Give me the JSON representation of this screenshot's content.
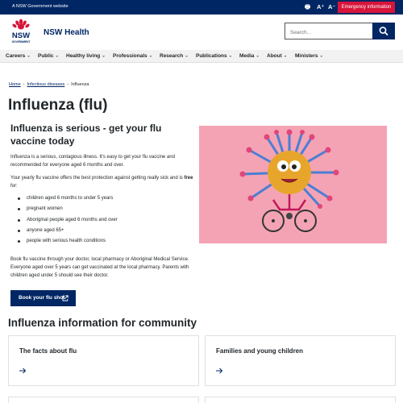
{
  "masthead": {
    "gov_label": "A NSW Government website",
    "print_label": "🖶",
    "font_up_label": "A⁺",
    "font_down_label": "A⁻",
    "emergency_label": "Emergency information"
  },
  "header": {
    "logo_text": "NSW",
    "logo_subtext": "GOVERNMENT",
    "brand": "NSW Health",
    "search_placeholder": "Search..."
  },
  "nav": {
    "items": [
      {
        "label": "Careers"
      },
      {
        "label": "Public"
      },
      {
        "label": "Healthy living"
      },
      {
        "label": "Professionals"
      },
      {
        "label": "Research"
      },
      {
        "label": "Publications"
      },
      {
        "label": "Media"
      },
      {
        "label": "About"
      },
      {
        "label": "Ministers"
      }
    ]
  },
  "breadcrumb": {
    "home": "Home",
    "section": "Infectious diseases",
    "current": "Influenza"
  },
  "page_title": "Influenza (flu)",
  "hero": {
    "title": "Influenza is serious - get your flu vaccine today",
    "intro": "Influenza is a serious, contagious illness. It's easy to get your flu vaccine and recommended for everyone aged 6 months and over.",
    "offer_prefix": "Your yearly flu vaccine offers the best protection against getting really sick and is ",
    "offer_bold": "free",
    "offer_suffix": " for:",
    "bullets": [
      "children aged 6 months to under 5 years",
      "pregnant women",
      "Aboriginal people aged 6 months and over",
      "anyone aged 65+",
      "people with serious health conditions"
    ],
    "booking_text": "Book flu vaccine through your doctor, local pharmacy or Aboriginal Medical Service. Everyone aged over 5 years can get vaccinated at the local pharmacy. Parents with children aged under 5 should see their doctor.",
    "button_label": "Book your flu shot"
  },
  "section_title": "Influenza information for community",
  "cards": [
    {
      "title": "The facts about flu"
    },
    {
      "title": "Families and young children"
    }
  ],
  "colors": {
    "navy": "#002664",
    "red": "#d7153a",
    "hero_bg": "#f4a3b4",
    "nav_bg": "#f2f2f2"
  }
}
